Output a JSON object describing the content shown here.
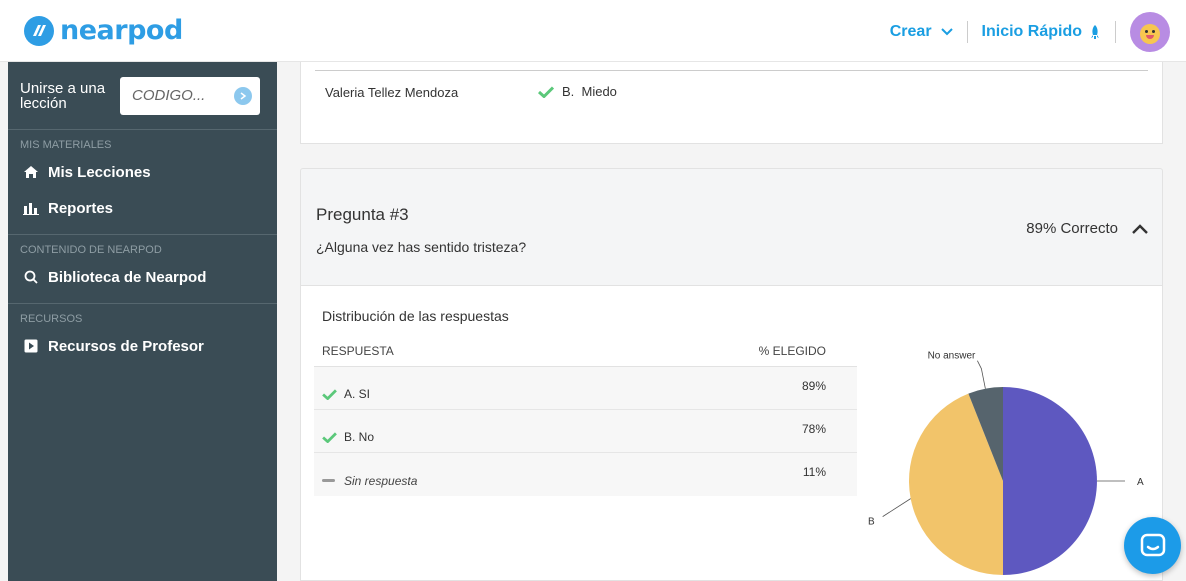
{
  "header": {
    "logo_text": "nearpod",
    "create_label": "Crear",
    "quick_start_label": "Inicio Rápido"
  },
  "sidebar": {
    "join_label_line1": "Unirse a una",
    "join_label_line2": "lección",
    "code_placeholder": "CODIGO...",
    "sections": [
      {
        "title": "MIS MATERIALES",
        "items": [
          {
            "label": "Mis Lecciones",
            "icon": "home-icon"
          },
          {
            "label": "Reportes",
            "icon": "bar-chart-icon"
          }
        ]
      },
      {
        "title": "CONTENIDO DE NEARPOD",
        "items": [
          {
            "label": "Biblioteca de Nearpod",
            "icon": "search-icon"
          }
        ]
      },
      {
        "title": "RECURSOS",
        "items": [
          {
            "label": "Recursos de Profesor",
            "icon": "play-icon"
          }
        ]
      }
    ]
  },
  "previous_answer": {
    "student": "Valeria Tellez Mendoza",
    "answer": "B.  Miedo"
  },
  "question": {
    "title": "Pregunta #3",
    "text": "¿Alguna vez has sentido tristeza?",
    "score": "89% Correcto"
  },
  "distribution": {
    "title": "Distribución de las respuestas",
    "col_answer": "RESPUESTA",
    "col_percent": "% ELEGIDO",
    "rows": [
      {
        "answer": "A. SI",
        "percent": "89%",
        "correct": true
      },
      {
        "answer": "B. No",
        "percent": "78%",
        "correct": true
      },
      {
        "answer": "Sin respuesta",
        "percent": "11%",
        "correct": false
      }
    ]
  },
  "chart_data": {
    "type": "pie",
    "slices": [
      {
        "label": "A",
        "value": 50,
        "color": "#5e58c0"
      },
      {
        "label": "B",
        "value": 44,
        "color": "#f2c46a"
      },
      {
        "label": "No answer",
        "value": 6,
        "color": "#56646d"
      }
    ]
  },
  "colors": {
    "accent": "#1a9ee2",
    "sidebar": "#3a4c55",
    "check": "#5bc87a"
  }
}
